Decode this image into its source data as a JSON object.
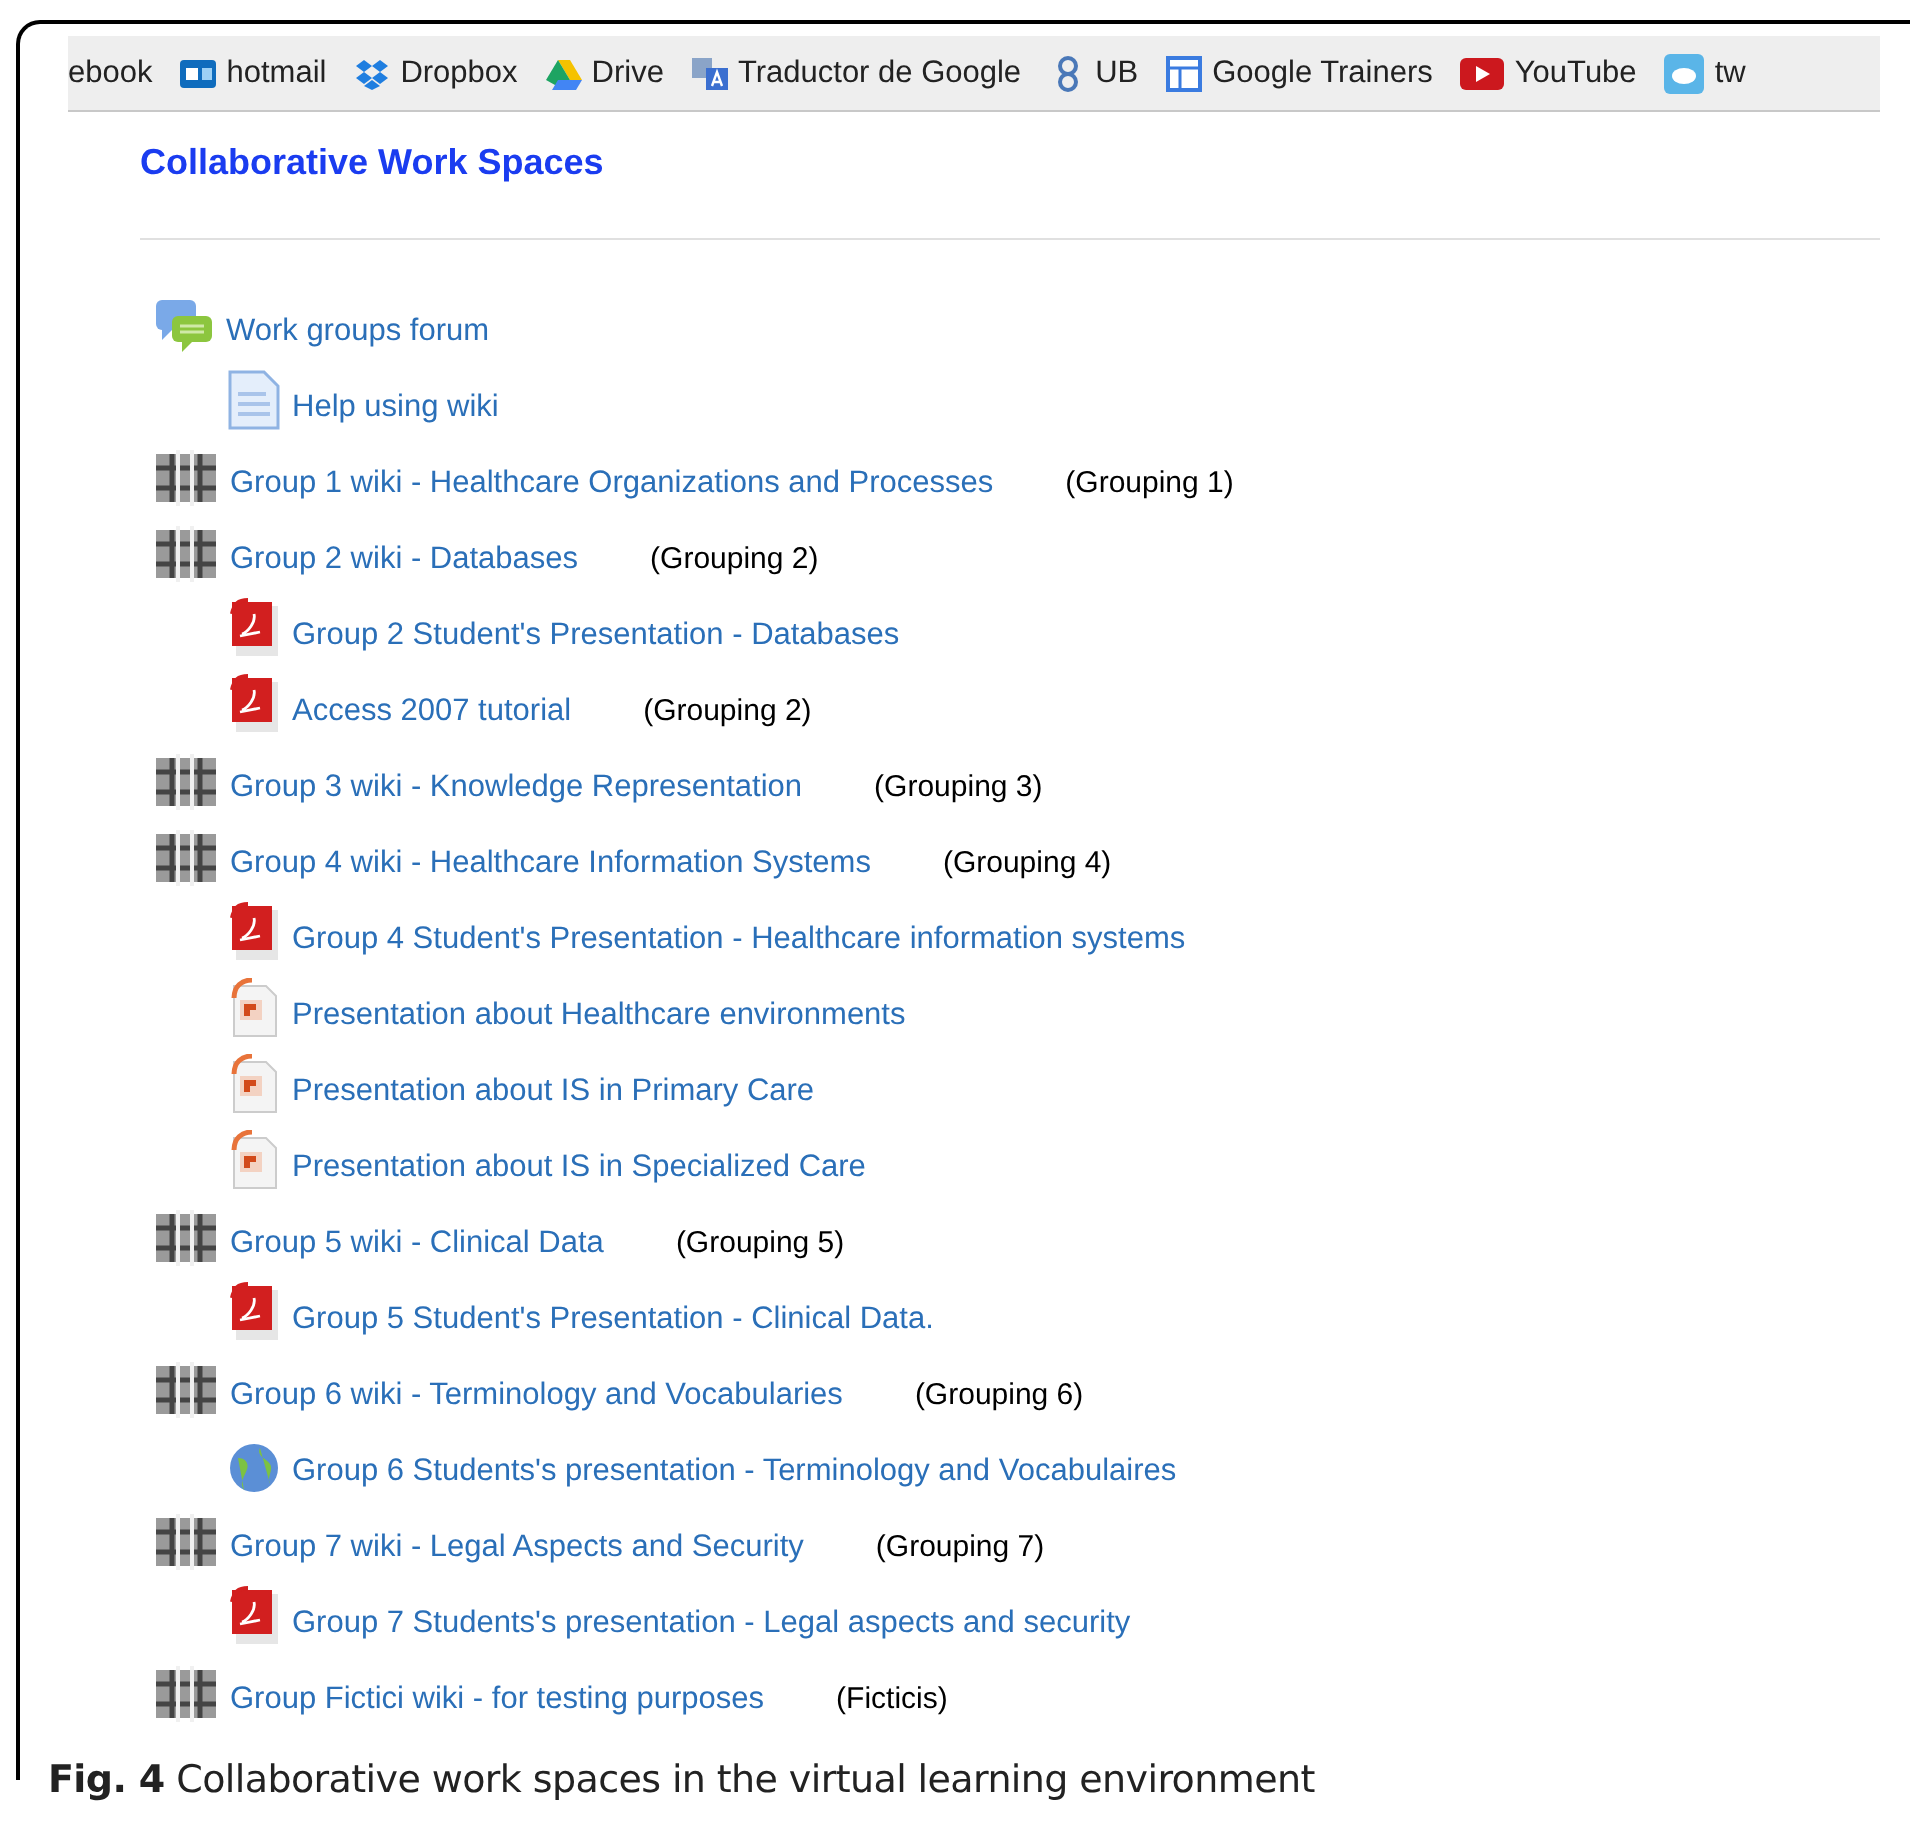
{
  "bookmarks": [
    {
      "kind": "page",
      "label": "ebook"
    },
    {
      "kind": "mail",
      "label": "hotmail"
    },
    {
      "kind": "box",
      "label": "Dropbox"
    },
    {
      "kind": "drive",
      "label": "Drive"
    },
    {
      "kind": "translate",
      "label": "Traductor de Google"
    },
    {
      "kind": "logo",
      "label": "UB"
    },
    {
      "kind": "window",
      "label": "Google Trainers"
    },
    {
      "kind": "video",
      "label": "YouTube"
    },
    {
      "kind": "bird",
      "label": "tw"
    }
  ],
  "section": {
    "title": "Collaborative Work Spaces"
  },
  "items": [
    {
      "kind": "forum",
      "label": "Work groups forum",
      "children": [
        {
          "kind": "page",
          "label": "Help using wiki"
        }
      ]
    },
    {
      "kind": "wiki",
      "label": "Group 1 wiki - Healthcare Organizations and Processes",
      "grouping": "(Grouping 1)"
    },
    {
      "kind": "wiki",
      "label": "Group 2 wiki - Databases",
      "grouping": "(Grouping 2)",
      "children": [
        {
          "kind": "pdf",
          "label": "Group 2 Student's Presentation - Databases"
        },
        {
          "kind": "pdf",
          "label": "Access 2007 tutorial",
          "grouping": "(Grouping 2)"
        }
      ]
    },
    {
      "kind": "wiki",
      "label": "Group 3 wiki - Knowledge Representation",
      "grouping": "(Grouping 3)"
    },
    {
      "kind": "wiki",
      "label": "Group 4 wiki - Healthcare Information Systems",
      "grouping": "(Grouping 4)",
      "children": [
        {
          "kind": "pdf",
          "label": "Group 4 Student's Presentation - Healthcare information systems"
        },
        {
          "kind": "slides",
          "label": "Presentation about Healthcare environments"
        },
        {
          "kind": "slides",
          "label": "Presentation about IS in Primary Care"
        },
        {
          "kind": "slides",
          "label": "Presentation about IS in Specialized Care"
        }
      ]
    },
    {
      "kind": "wiki",
      "label": "Group 5 wiki - Clinical Data",
      "grouping": "(Grouping 5)",
      "children": [
        {
          "kind": "pdf",
          "label": "Group 5 Student's Presentation - Clinical Data."
        }
      ]
    },
    {
      "kind": "wiki",
      "label": "Group 6 wiki - Terminology and Vocabularies",
      "grouping": "(Grouping 6)",
      "children": [
        {
          "kind": "globe",
          "label": "Group 6 Students's presentation - Terminology and Vocabulaires"
        }
      ]
    },
    {
      "kind": "wiki",
      "label": "Group 7 wiki - Legal Aspects and Security",
      "grouping": "(Grouping 7)",
      "children": [
        {
          "kind": "pdf",
          "label": "Group 7 Students's presentation - Legal aspects and security"
        }
      ]
    },
    {
      "kind": "wiki",
      "label": "Group Fictici wiki - for testing purposes",
      "grouping": "(Ficticis)"
    }
  ],
  "caption": {
    "label": "Fig. 4",
    "text": "Collaborative work spaces in the virtual learning environment"
  }
}
